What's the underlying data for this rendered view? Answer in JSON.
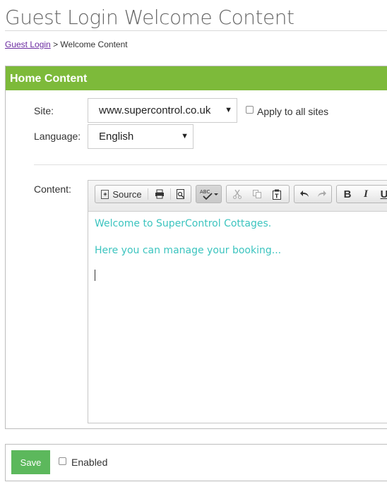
{
  "page": {
    "title": "Guest Login Welcome Content"
  },
  "breadcrumb": {
    "link": "Guest Login",
    "separator": ">",
    "current": "Welcome Content"
  },
  "panel": {
    "header": "Home Content",
    "site_label": "Site:",
    "site_value": "www.supercontrol.co.uk",
    "apply_all_label": "Apply to all sites",
    "language_label": "Language:",
    "language_value": "English",
    "content_label": "Content:"
  },
  "toolbar": {
    "source_label": "Source",
    "icons": [
      "source-icon",
      "print-icon",
      "preview-icon",
      "spellcheck-icon",
      "cut-icon",
      "copy-icon",
      "paste-text-icon",
      "undo-icon",
      "redo-icon",
      "bold-icon",
      "italic-icon",
      "underline-icon"
    ],
    "bold_label": "B",
    "italic_label": "I",
    "underline_label": "U"
  },
  "editor": {
    "line1": "Welcome to SuperControl Cottages.",
    "line2": "Here you can manage your booking...",
    "text_color": "#3cc4bf"
  },
  "footer": {
    "save_label": "Save",
    "enabled_label": "Enabled"
  },
  "colors": {
    "header_green": "#7dba3a",
    "save_green": "#5cb85c"
  }
}
